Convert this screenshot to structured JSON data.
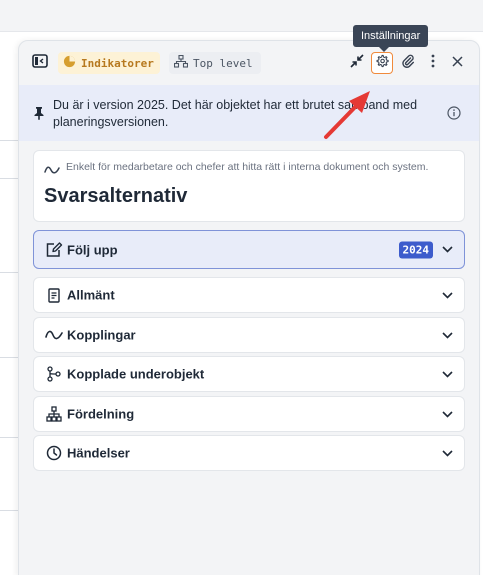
{
  "toolbar": {
    "chips": [
      {
        "label": "Indikatorer",
        "icon": "pie-chart-icon",
        "color": "#b7791f"
      },
      {
        "label": "Top level",
        "icon": "hierarchy-icon",
        "color": "#4b5563"
      }
    ],
    "tooltip": "Inställningar",
    "icons": [
      "sidebar-toggle-icon",
      "collapse-icon",
      "settings-icon",
      "paperclip-icon",
      "more-vertical-icon",
      "close-icon"
    ]
  },
  "banner": {
    "icon": "pin-icon",
    "text": "Du är i version 2025. Det här objektet har ett brutet samband med planeringsversionen.",
    "info_icon": "info-icon"
  },
  "object": {
    "subtitle": "Enkelt för medarbetare och chefer att hitta rätt i interna dokument och system.",
    "title": "Svarsalternativ"
  },
  "sections": [
    {
      "label": "Följ upp",
      "icon": "edit-icon",
      "badge": "2024",
      "active": true
    },
    {
      "label": "Allmänt",
      "icon": "document-icon"
    },
    {
      "label": "Kopplingar",
      "icon": "link-wave-icon"
    },
    {
      "label": "Kopplade underobjekt",
      "icon": "branch-icon"
    },
    {
      "label": "Fördelning",
      "icon": "org-chart-icon"
    },
    {
      "label": "Händelser",
      "icon": "clock-icon"
    }
  ],
  "colors": {
    "accent": "#3d5ccc",
    "highlight": "#f08a3c",
    "annotation_arrow": "#e53935"
  }
}
